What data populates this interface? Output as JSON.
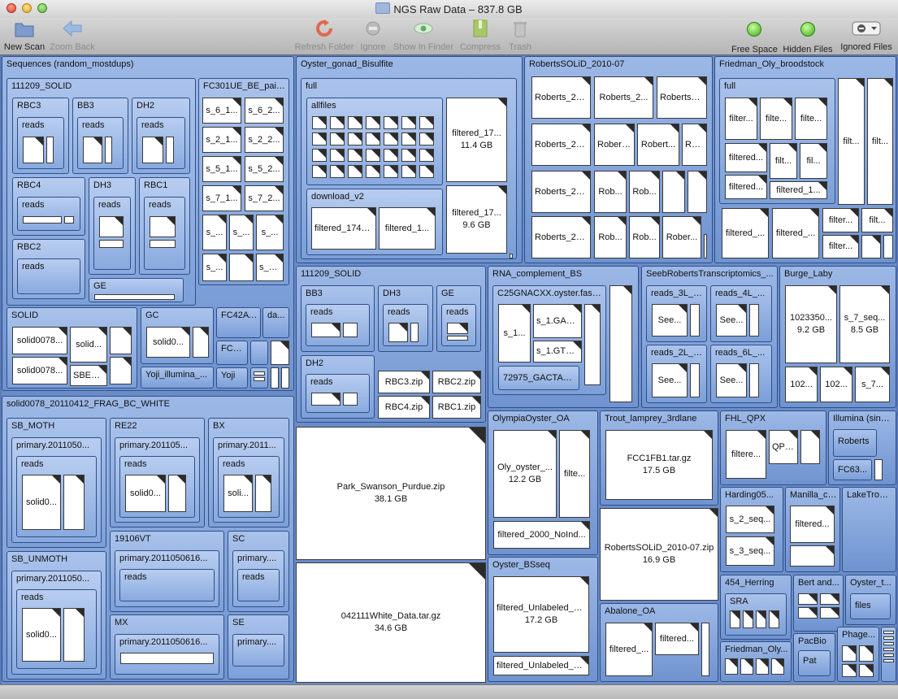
{
  "window": {
    "title": "NGS Raw Data – 837.8 GB"
  },
  "toolbar": {
    "new_scan": "New Scan",
    "zoom_back": "Zoom Back",
    "refresh_folder": "Refresh Folder",
    "ignore": "Ignore",
    "show_in_finder": "Show In Finder",
    "compress": "Compress",
    "trash": "Trash",
    "free_space": "Free Space",
    "hidden_files": "Hidden Files",
    "ignored_files": "Ignored Files"
  },
  "map": {
    "seq": {
      "title": "Sequences (random_mostdups)",
      "s111209": {
        "title": "111209_SOLID",
        "rbc3": "RBC3",
        "bb3": "BB3",
        "dh2": "DH2",
        "rbc4": "RBC4",
        "dh3": "DH3",
        "rbc1": "RBC1",
        "rbc2": "RBC2",
        "ge": "GE",
        "reads": "reads"
      },
      "fc301": {
        "title": "FC301UE_BE_paired",
        "f": [
          "s_6_1...",
          "s_6_2...",
          "s_2_1...",
          "s_2_2...",
          "s_5_1...",
          "s_5_2...",
          "s_7_1...",
          "s_7_2...",
          "s_...",
          "s_...",
          "s_...",
          "s_...",
          "s_4..."
        ]
      },
      "solid": {
        "title": "SOLID",
        "f": [
          "solid0078...",
          "solid...",
          "solid0078...",
          "SBEA..."
        ]
      },
      "gc": {
        "title": "GC",
        "f": [
          "solid0..."
        ]
      },
      "fc42": "FC42AT0",
      "da": "da...",
      "fc4": "FC4...",
      "yoji_illumina": "Yoji_illumina_...",
      "yoji": "Yoji"
    },
    "solid0078": {
      "title": "solid0078_20110412_FRAG_BC_WHITE",
      "sb_moth": "SB_MOTH",
      "re22": "RE22",
      "bx": "BX",
      "sb_unmoth": "SB_UNMOTH",
      "v19106": "19106VT",
      "sc": "SC",
      "mx": "MX",
      "se": "SE",
      "primary_a": "primary.2011050...",
      "primary_b": "primary.201105...",
      "primary_c": "primary.2011...",
      "primary_d": "primary.2011050616...",
      "primary_e": "primary....",
      "reads": "reads",
      "solid0": "solid0...",
      "soli": "soli..."
    },
    "oyster": {
      "title": "Oyster_gonad_Bisulfite",
      "full": "full",
      "allfiles": "allfiles",
      "download": "download_v2",
      "f1": {
        "name": "filtered_17...",
        "size": "11.4 GB"
      },
      "f2": {
        "name": "filtered_17...",
        "size": "9.6 GB"
      },
      "f3": "filtered_174g...",
      "f4": "filtered_1..."
    },
    "roberts": {
      "title": "RobertsSOLiD_2010-07",
      "f": [
        "Roberts_20...",
        "Roberts_2...",
        "Roberts_2...",
        "Roberts_20...",
        "Robert...",
        "Robert...",
        "Ro...",
        "Roberts_20...",
        "Rob...",
        "Rob...",
        "Roberts_20...",
        "Rob...",
        "Rob...",
        "Rober..."
      ]
    },
    "friedman": {
      "title": "Friedman_Oly_broodstock",
      "full": "full",
      "f": [
        "filter...",
        "filte...",
        "filte...",
        "filtered...",
        "filt...",
        "fil...",
        "filtered...",
        "filtered_1...",
        "filt...",
        "filt...",
        "filtered_...",
        "filtered_...",
        "filter...",
        "filt...",
        "filter..."
      ]
    },
    "s111209b": {
      "title": "111209_SOLID",
      "bb3": "BB3",
      "dh3": "DH3",
      "ge": "GE",
      "dh2": "DH2",
      "reads": "reads",
      "rbc3": "RBC3.zip",
      "rbc2": "RBC2.zip",
      "rbc4": "RBC4.zip",
      "rbc1": "RBC1.zip"
    },
    "rna": {
      "title": "RNA_complement_BS",
      "c25": "C25GNACXX.oyster.fastqs",
      "f1": "s_1...",
      "f2": "s_1.GAC...",
      "f3": "s_1.GTG...",
      "f4": "72975_GACTAAGA et al"
    },
    "seeb": {
      "title": "SeebRobertsTranscriptomics_...",
      "r3l": "reads_3L_h...",
      "r4l": "reads_4L_...",
      "r2l": "reads_2L_h...",
      "r6l": "reads_6L_...",
      "see": "See..."
    },
    "burge": {
      "title": "Burge_Laby",
      "f1": {
        "name": "1023350...",
        "size": "9.2 GB"
      },
      "f2": {
        "name": "s_7_seq...",
        "size": "8.5 GB"
      },
      "f3": "102...",
      "f4": "102...",
      "f5": "s_7..."
    },
    "park": {
      "name": "Park_Swanson_Purdue.zip",
      "size": "38.1 GB"
    },
    "white": {
      "name": "042111White_Data.tar.gz",
      "size": "34.6 GB"
    },
    "olympia": {
      "title": "OlympiaOyster_OA",
      "f1": {
        "name": "Oly_oyster_...",
        "size": "12.2 GB"
      },
      "f2": "filte...",
      "f3": "filtered_2000_NoInd..."
    },
    "trout": {
      "title": "Trout_lamprey_3rdlane",
      "f": {
        "name": "FCC1FB1.tar.gz",
        "size": "17.5 GB"
      }
    },
    "roberts_zip": {
      "name": "RobertsSOLiD_2010-07.zip",
      "size": "16.9 GB"
    },
    "oysterbs": {
      "title": "Oyster_BSseq",
      "f1": {
        "name": "filtered_Unlabeled_N...",
        "size": "17.2 GB"
      },
      "f2": "filtered_Unlabeled_N..."
    },
    "abalone": {
      "title": "Abalone_OA",
      "f1": "filtered_...",
      "f2": "filtered..."
    },
    "fhl": {
      "title": "FHL_QPX",
      "f1": "filtere...",
      "f2": "QPX_..."
    },
    "illumina": {
      "title": "Illumina (single)",
      "roberts": "Roberts",
      "fc63": "FC63..."
    },
    "harding": {
      "title": "Harding05...",
      "f1": "s_2_seq...",
      "f2": "s_3_seq..."
    },
    "manilla": {
      "title": "Manilla_cl...",
      "f1": "filtered..."
    },
    "laketrout": {
      "title": "LakeTrout..."
    },
    "herring": {
      "title": "454_Herring",
      "sra": "SRA"
    },
    "bert": {
      "title": "Bert and..."
    },
    "oystert": {
      "title": "Oyster_t...",
      "files": "files"
    },
    "friedman2": {
      "title": "Friedman_Oly..."
    },
    "pacbio": {
      "title": "PacBio",
      "pat": "Pat"
    },
    "phage": {
      "title": "Phage..."
    }
  }
}
